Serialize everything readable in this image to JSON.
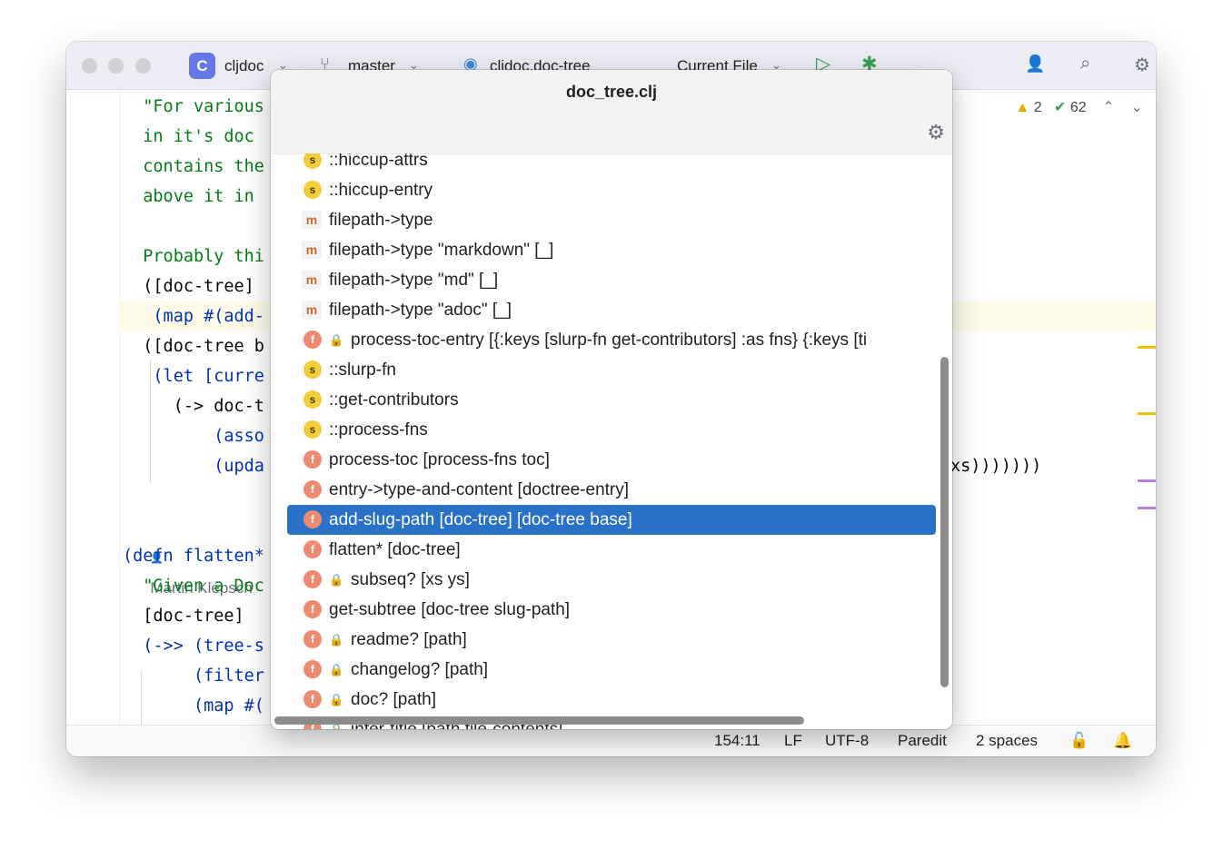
{
  "titlebar": {
    "project_badge": "C",
    "project_name": "cljdoc",
    "branch": "master",
    "run_config": "cljdoc.doc-tree",
    "scope": "Current File"
  },
  "inspections": {
    "warnings": "2",
    "checks": "62"
  },
  "code_lines": [
    "  \"For various",
    "  in it's doc",
    "  contains the",
    "  above it in",
    "",
    "  Probably thi",
    "  ([doc-tree]",
    "   (map #(add-",
    "  ([doc-tree b",
    "   (let [curre",
    "     (-> doc-t",
    "         (asso",
    "         (upda",
    "",
    "(defn flatten*",
    "  \"Given a Doc",
    "  [doc-tree]",
    "  (->> (tree-s",
    "       (filter",
    "       (map #("
  ],
  "code_tail": "xs)))))))",
  "author": "Martin Klepsch",
  "popup": {
    "title": "doc_tree.clj",
    "items": [
      {
        "kind": "s",
        "locked": false,
        "label": "::hiccup-attrs"
      },
      {
        "kind": "s",
        "locked": false,
        "label": "::hiccup-entry"
      },
      {
        "kind": "m",
        "locked": false,
        "label": "filepath->type"
      },
      {
        "kind": "m",
        "locked": false,
        "label": "filepath->type \"markdown\" [_]"
      },
      {
        "kind": "m",
        "locked": false,
        "label": "filepath->type \"md\" [_]"
      },
      {
        "kind": "m",
        "locked": false,
        "label": "filepath->type \"adoc\" [_]"
      },
      {
        "kind": "f",
        "locked": true,
        "label": "process-toc-entry [{:keys [slurp-fn get-contributors] :as fns}    {:keys [ti"
      },
      {
        "kind": "s",
        "locked": false,
        "label": "::slurp-fn"
      },
      {
        "kind": "s",
        "locked": false,
        "label": "::get-contributors"
      },
      {
        "kind": "s",
        "locked": false,
        "label": "::process-fns"
      },
      {
        "kind": "f",
        "locked": false,
        "label": "process-toc [process-fns toc]"
      },
      {
        "kind": "f",
        "locked": false,
        "label": "entry->type-and-content [doctree-entry]"
      },
      {
        "kind": "f",
        "locked": false,
        "label": "add-slug-path [doc-tree] [doc-tree base]",
        "selected": true
      },
      {
        "kind": "f",
        "locked": false,
        "label": "flatten* [doc-tree]"
      },
      {
        "kind": "f",
        "locked": true,
        "label": "subseq? [xs ys]"
      },
      {
        "kind": "f",
        "locked": false,
        "label": "get-subtree [doc-tree slug-path]"
      },
      {
        "kind": "f",
        "locked": true,
        "label": "readme? [path]"
      },
      {
        "kind": "f",
        "locked": true,
        "label": "changelog? [path]"
      },
      {
        "kind": "f",
        "locked": true,
        "label": "doc? [path]"
      },
      {
        "kind": "f",
        "locked": true,
        "label": "infer-title [path file-contents]"
      }
    ]
  },
  "statusbar": {
    "position": "154:11",
    "line_sep": "LF",
    "encoding": "UTF-8",
    "mode": "Paredit",
    "indent": "2 spaces"
  },
  "colors": {
    "selection": "#2a72c7",
    "string": "#067d17",
    "keyword": "#0033b3",
    "fn_badge": "#f08a6e",
    "spec_badge": "#f4cc3a"
  }
}
